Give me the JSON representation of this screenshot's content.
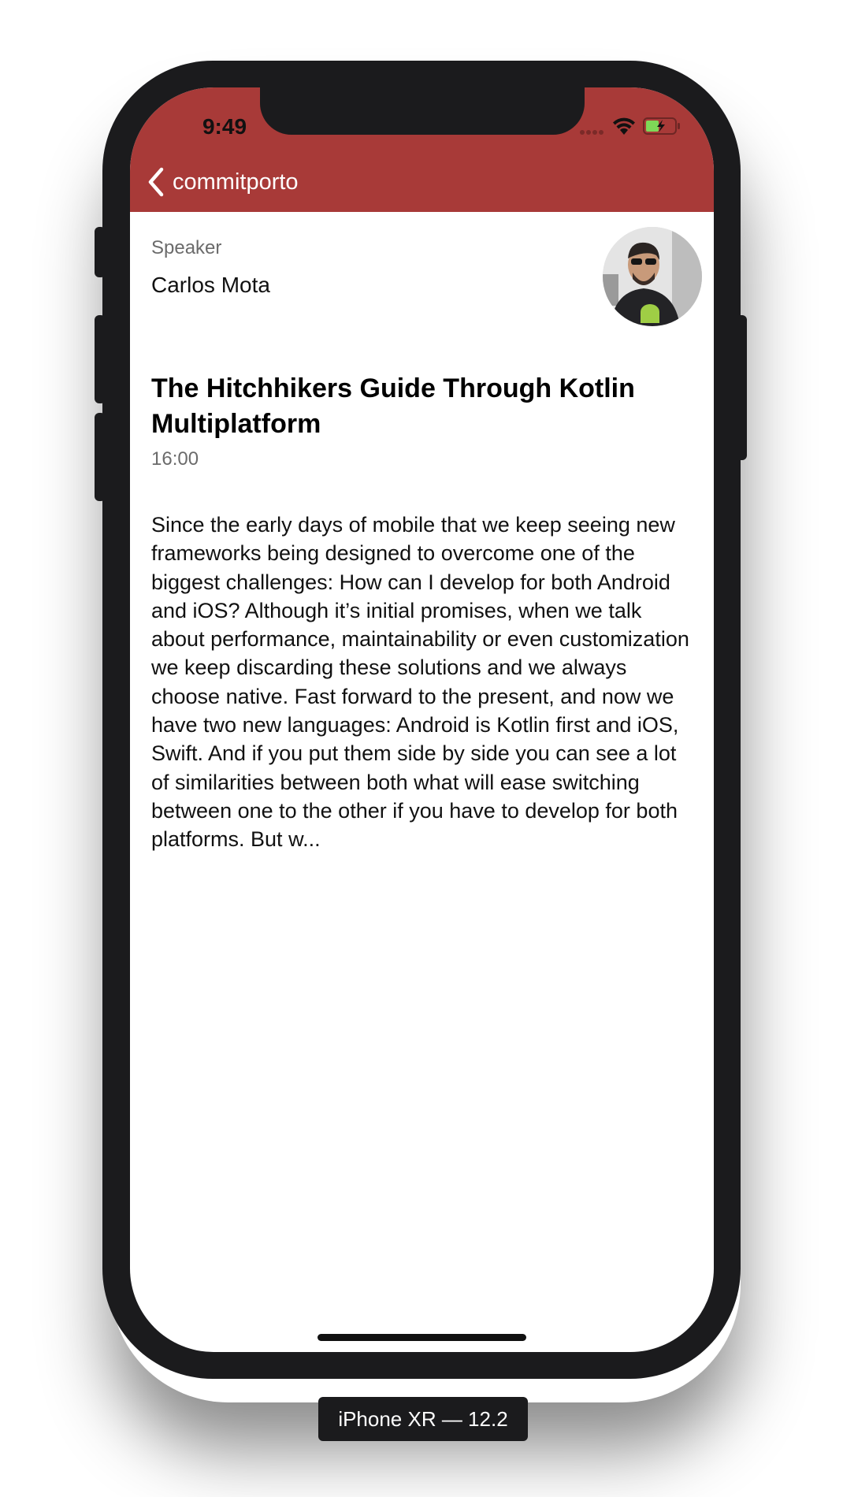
{
  "status_bar": {
    "time": "9:49"
  },
  "nav": {
    "back_label": "commitporto"
  },
  "speaker": {
    "caption": "Speaker",
    "name": "Carlos Mota"
  },
  "talk": {
    "title": "The Hitchhikers Guide Through Kotlin Multiplatform",
    "time": "16:00",
    "description": "Since the early days of mobile that we keep seeing new frameworks being designed to overcome one of the biggest challenges: How can I develop for both Android and iOS? Although it’s initial promises, when we talk about performance, maintainability or even customization we keep discarding these solutions and we always choose native. Fast forward to the present, and now we have two new languages: Android is Kotlin first and iOS, Swift. And if you put them side by side you can see a lot of similarities between both what will ease switching between one to the other if you have to develop for both platforms. But w..."
  },
  "device_label": "iPhone XR — 12.2",
  "colors": {
    "nav_bar": "#a83a38",
    "battery_fill": "#7ed957"
  },
  "icons": {
    "back": "chevron-left-icon",
    "signal": "cellular-signal-icon",
    "wifi": "wifi-icon",
    "battery": "battery-charging-icon"
  }
}
